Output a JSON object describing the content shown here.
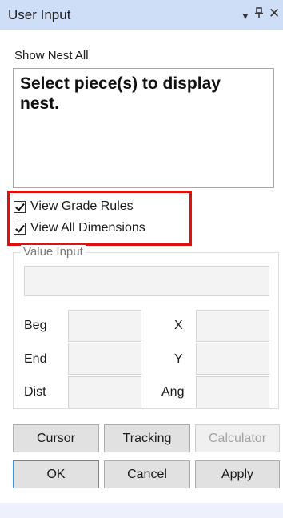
{
  "titlebar": {
    "title": "User Input",
    "icons": [
      "dropdown-icon",
      "pin-icon",
      "close-icon"
    ]
  },
  "show_nest": {
    "label": "Show Nest All",
    "message": "Select piece(s) to display nest."
  },
  "options": {
    "highlight_color": "#e01010",
    "items": [
      {
        "label": "View Grade Rules",
        "checked": true
      },
      {
        "label": "View All Dimensions",
        "checked": true
      }
    ]
  },
  "value_input": {
    "title": "Value Input",
    "value": "",
    "fields": {
      "beg": {
        "label": "Beg",
        "value": ""
      },
      "end": {
        "label": "End",
        "value": ""
      },
      "dist": {
        "label": "Dist",
        "value": ""
      },
      "x": {
        "label": "X",
        "value": ""
      },
      "y": {
        "label": "Y",
        "value": ""
      },
      "ang": {
        "label": "Ang",
        "value": ""
      }
    }
  },
  "buttons": {
    "cursor": "Cursor",
    "tracking": "Tracking",
    "calculator": "Calculator",
    "ok": "OK",
    "cancel": "Cancel",
    "apply": "Apply"
  },
  "colors": {
    "titlebar": "#cfdef7",
    "accent": "#3c8ee0"
  }
}
